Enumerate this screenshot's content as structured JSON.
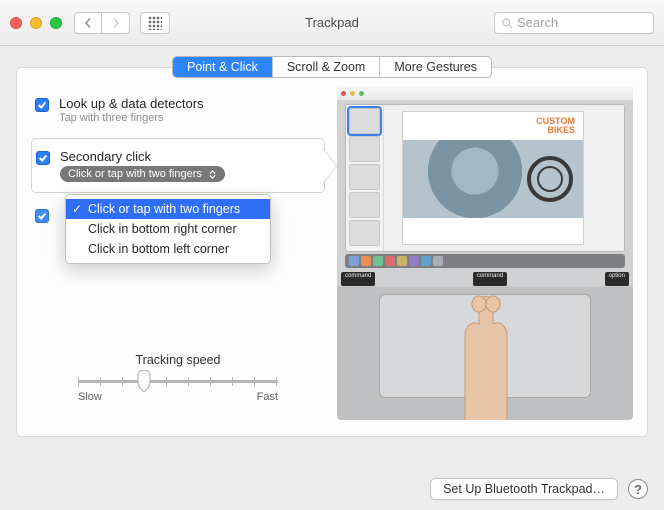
{
  "window": {
    "title": "Trackpad",
    "search_placeholder": "Search"
  },
  "tabs": [
    "Point & Click",
    "Scroll & Zoom",
    "More Gestures"
  ],
  "settings": {
    "lookup": {
      "title": "Look up & data detectors",
      "subtitle": "Tap with three fingers"
    },
    "secondary": {
      "title": "Secondary click",
      "selected": "Click or tap with two fingers"
    },
    "secondary_options": [
      "Click or tap with two fingers",
      "Click in bottom right corner",
      "Click in bottom left corner"
    ]
  },
  "slider": {
    "label": "Tracking speed",
    "min_label": "Slow",
    "max_label": "Fast"
  },
  "preview": {
    "poster_line1": "CUSTOM",
    "poster_line2": "BIKES",
    "key_command": "command",
    "key_option": "option"
  },
  "footer": {
    "bluetooth": "Set Up Bluetooth Trackpad…",
    "help": "?"
  }
}
